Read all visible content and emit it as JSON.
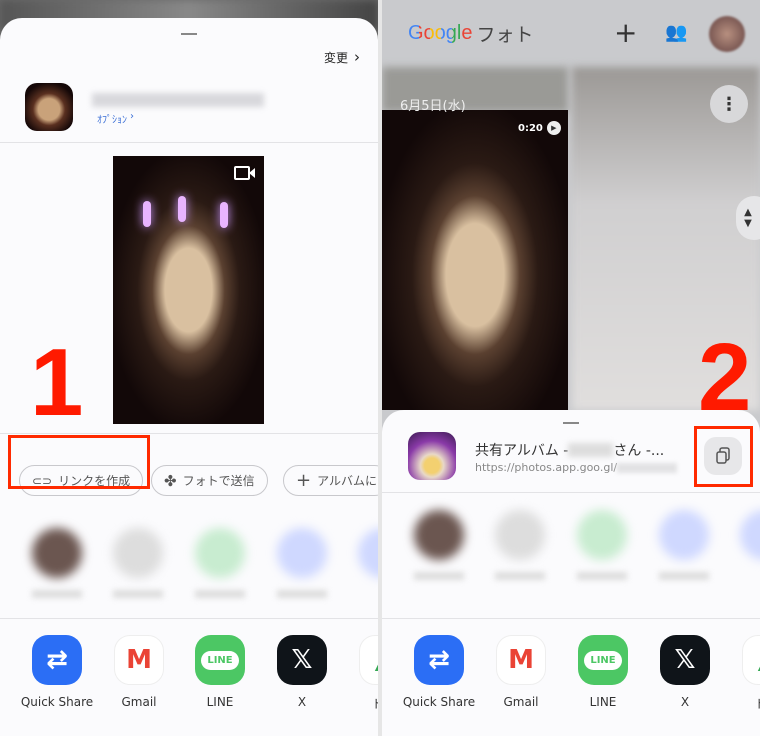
{
  "left": {
    "change_label": "変更",
    "options_label": "ｵﾌﾟｼｮﾝ",
    "step_number": "1",
    "chips": [
      {
        "label": "リンクを作成",
        "icon": "link-icon"
      },
      {
        "label": "フォトで送信",
        "icon": "pinwheel-icon"
      },
      {
        "label": "アルバムに",
        "icon": "plus-icon"
      }
    ],
    "apps": [
      {
        "label": "Quick Share",
        "color": "#2b6ef5"
      },
      {
        "label": "Gmail",
        "color": "#ffffff"
      },
      {
        "label": "LINE",
        "color": "#4cc764"
      },
      {
        "label": "X",
        "color": "#0f1419"
      },
      {
        "label": "ドラ",
        "color": "#ffffff"
      }
    ]
  },
  "right": {
    "app_logo": "Google",
    "app_title": "フォト",
    "date_label": "6月5日(水)",
    "video_duration": "0:20",
    "step_number": "2",
    "share_title_prefix": "共有アルバム - ",
    "share_title_suffix": " さん -...",
    "share_url": "https://photos.app.goo.gl/",
    "apps": [
      {
        "label": "Quick Share"
      },
      {
        "label": "Gmail"
      },
      {
        "label": "LINE"
      },
      {
        "label": "X"
      },
      {
        "label": "ドラ"
      }
    ]
  }
}
